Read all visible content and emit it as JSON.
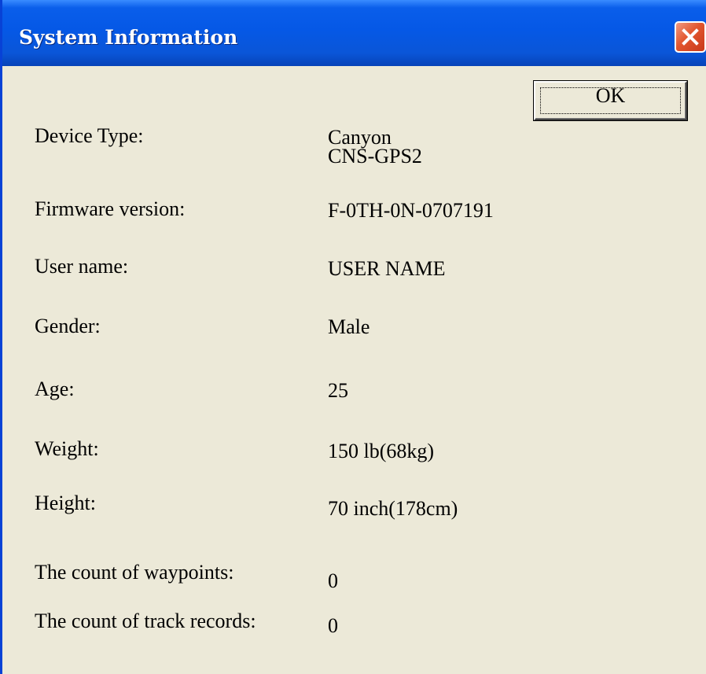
{
  "window": {
    "title": "System Information",
    "close_icon": "close-icon",
    "accent_title_color": "#0558E6",
    "close_color": "#E2562E",
    "background": "#ECE9D8"
  },
  "ok_button": {
    "label": "OK"
  },
  "fields": {
    "device_type": {
      "label": "Device Type:",
      "value": "Canyon\nCNS-GPS2"
    },
    "firmware_version": {
      "label": "Firmware version:",
      "value": "F-0TH-0N-0707191"
    },
    "user_name": {
      "label": "User name:",
      "value": "USER NAME"
    },
    "gender": {
      "label": "Gender:",
      "value": "Male"
    },
    "age": {
      "label": "Age:",
      "value": "25"
    },
    "weight": {
      "label": "Weight:",
      "value": "150 lb(68kg)"
    },
    "height": {
      "label": "Height:",
      "value": "70 inch(178cm)"
    },
    "waypoints": {
      "label": "The count of waypoints:",
      "value": "0"
    },
    "track_records": {
      "label": "The count of track records:",
      "value": "0"
    }
  }
}
